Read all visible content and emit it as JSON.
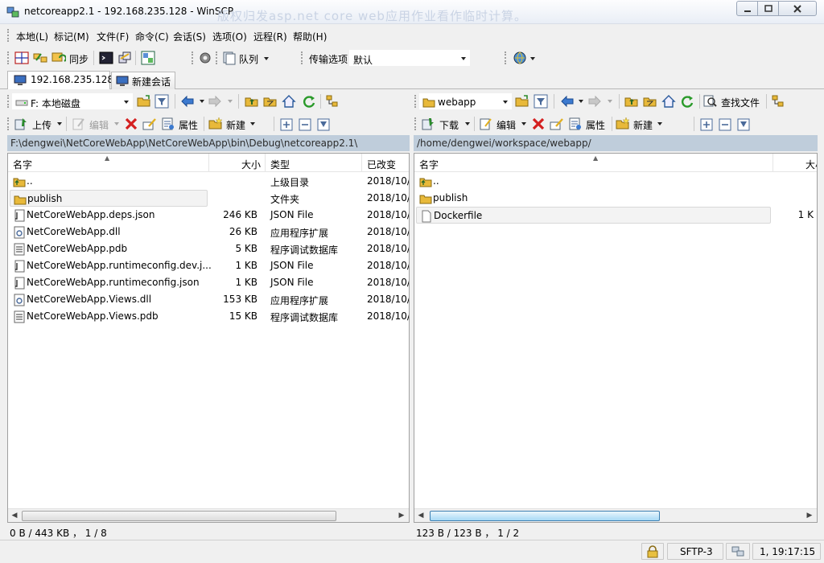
{
  "window": {
    "title": "netcoreapp2.1 - 192.168.235.128 - WinSCP",
    "watermark": "版权归发asp.net core web应用作业看作临时计算。"
  },
  "menu": [
    "本地(L)",
    "标记(M)",
    "文件(F)",
    "命令(C)",
    "会话(S)",
    "选项(O)",
    "远程(R)",
    "帮助(H)"
  ],
  "toolbar": {
    "sync_label": "同步",
    "queue_label": "队列",
    "transfer_options_label": "传输选项",
    "transfer_preset": "默认"
  },
  "tabs": [
    {
      "label": "192.168.235.128"
    },
    {
      "label": "新建会话"
    }
  ],
  "local": {
    "drive": "F: 本地磁盘",
    "upload_label": "上传",
    "edit_label": "编辑",
    "properties_label": "属性",
    "new_label": "新建",
    "path": "F:\\dengwei\\NetCoreWebApp\\NetCoreWebApp\\bin\\Debug\\netcoreapp2.1\\",
    "columns": {
      "name": "名字",
      "size": "大小",
      "type": "类型",
      "changed": "已改变"
    },
    "files": [
      {
        "name": "..",
        "size": "",
        "type": "上级目录",
        "changed": "2018/10/",
        "icon": "parent-folder-icon"
      },
      {
        "name": "publish",
        "size": "",
        "type": "文件夹",
        "changed": "2018/10/",
        "icon": "folder-icon"
      },
      {
        "name": "NetCoreWebApp.deps.json",
        "size": "246 KB",
        "type": "JSON File",
        "changed": "2018/10/",
        "icon": "json-file-icon"
      },
      {
        "name": "NetCoreWebApp.dll",
        "size": "26 KB",
        "type": "应用程序扩展",
        "changed": "2018/10/",
        "icon": "dll-file-icon"
      },
      {
        "name": "NetCoreWebApp.pdb",
        "size": "5 KB",
        "type": "程序调试数据库",
        "changed": "2018/10/",
        "icon": "pdb-file-icon"
      },
      {
        "name": "NetCoreWebApp.runtimeconfig.dev.j...",
        "size": "1 KB",
        "type": "JSON File",
        "changed": "2018/10/",
        "icon": "json-file-icon"
      },
      {
        "name": "NetCoreWebApp.runtimeconfig.json",
        "size": "1 KB",
        "type": "JSON File",
        "changed": "2018/10/",
        "icon": "json-file-icon"
      },
      {
        "name": "NetCoreWebApp.Views.dll",
        "size": "153 KB",
        "type": "应用程序扩展",
        "changed": "2018/10/",
        "icon": "dll-file-icon"
      },
      {
        "name": "NetCoreWebApp.Views.pdb",
        "size": "15 KB",
        "type": "程序调试数据库",
        "changed": "2018/10/",
        "icon": "pdb-file-icon"
      }
    ],
    "summary": "0 B / 443 KB ， 1 / 8"
  },
  "remote": {
    "folder": "webapp",
    "find_files_label": "查找文件",
    "download_label": "下载",
    "edit_label": "编辑",
    "properties_label": "属性",
    "new_label": "新建",
    "path": "/home/dengwei/workspace/webapp/",
    "columns": {
      "name": "名字",
      "size": "大小"
    },
    "files": [
      {
        "name": "..",
        "size": "",
        "icon": "parent-folder-icon"
      },
      {
        "name": "publish",
        "size": "",
        "icon": "folder-icon"
      },
      {
        "name": "Dockerfile",
        "size": "1 K",
        "icon": "file-icon"
      }
    ],
    "summary": "123 B / 123 B ， 1 / 2"
  },
  "status": {
    "protocol": "SFTP-3",
    "time": "1, 19:17:15"
  }
}
